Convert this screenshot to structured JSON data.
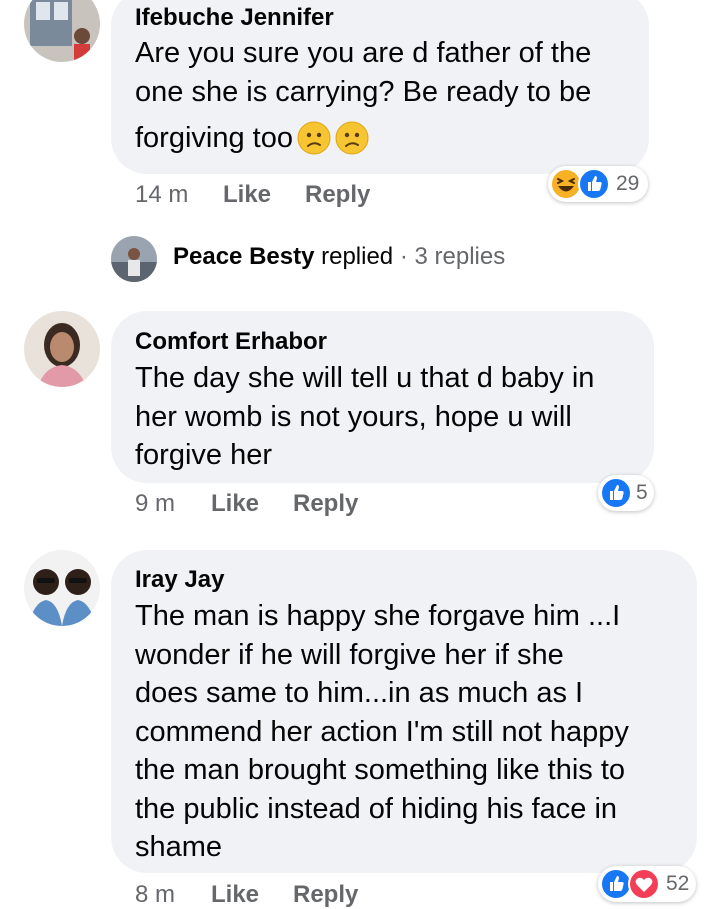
{
  "comments": [
    {
      "author": "Ifebuche Jennifer",
      "lines": [
        "Are you sure you are d father of the",
        "one she is carrying? Be ready to be",
        "forgiving too"
      ],
      "trailing_emoji": "confused-face-icon x2",
      "time": "14 m",
      "like_label": "Like",
      "reply_label": "Reply",
      "reaction_types": [
        "haha-icon",
        "like-icon"
      ],
      "reaction_count": "29"
    },
    {
      "author": "Comfort Erhabor",
      "lines": [
        "The day she will tell u that d baby in",
        "her womb is not yours, hope u will",
        "forgive her"
      ],
      "time": "9 m",
      "like_label": "Like",
      "reply_label": "Reply",
      "reaction_types": [
        "like-icon"
      ],
      "reaction_count": "5"
    },
    {
      "author": "Iray Jay",
      "lines": [
        "The man is happy she forgave him ...I",
        "wonder if he will forgive her  if she",
        "does same to him...in as much as I",
        "commend her action I'm still not happy",
        "the man brought something like this to",
        "the public instead of hiding his face in",
        "shame"
      ],
      "time": "8 m",
      "like_label": "Like",
      "reply_label": "Reply",
      "reaction_types": [
        "like-icon",
        "love-icon"
      ],
      "reaction_count": "52"
    }
  ],
  "replies_thread": {
    "name": "Peace Besty",
    "verb": "replied",
    "separator": " · ",
    "count": "3 replies"
  },
  "colors": {
    "bubble": "#f0f2f5",
    "meta_text": "#65676b",
    "like_blue": "#1877f2",
    "love_red": "#f33e58",
    "haha_yellow": "#f7b125"
  }
}
